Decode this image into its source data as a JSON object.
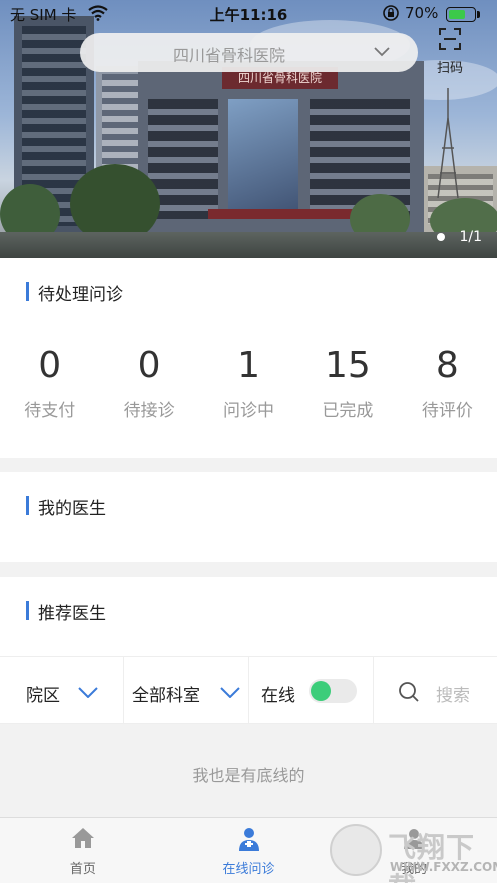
{
  "status_bar": {
    "carrier": "无 SIM 卡",
    "time": "上午11:16",
    "battery": "70%",
    "battery_level": 0.7
  },
  "header": {
    "hospital_name": "四川省骨科医院",
    "scan_label": "扫码",
    "banner_sign": "四川省骨科医院",
    "banner_indicator": "1/1"
  },
  "pending": {
    "title": "待处理问诊",
    "stats": [
      {
        "value": "0",
        "label": "待支付"
      },
      {
        "value": "0",
        "label": "待接诊"
      },
      {
        "value": "1",
        "label": "问诊中"
      },
      {
        "value": "15",
        "label": "已完成"
      },
      {
        "value": "8",
        "label": "待评价"
      }
    ]
  },
  "my_doctors": {
    "title": "我的医生"
  },
  "recommended": {
    "title": "推荐医生",
    "filters": {
      "campus": "院区",
      "department": "全部科室",
      "online": "在线",
      "online_enabled": true,
      "search_placeholder": "搜索"
    },
    "end_text": "我也是有底线的"
  },
  "tabbar": {
    "tabs": [
      {
        "label": "首页",
        "active": false
      },
      {
        "label": "在线问诊",
        "active": true
      },
      {
        "label": "我的",
        "active": false
      }
    ]
  },
  "watermark": {
    "brand": "飞翔下载",
    "site": "WWW.FXXZ.COM"
  },
  "colors": {
    "accent": "#3b7bd9",
    "toggle_on": "#3ccd7a",
    "battery": "#3cc94a"
  }
}
